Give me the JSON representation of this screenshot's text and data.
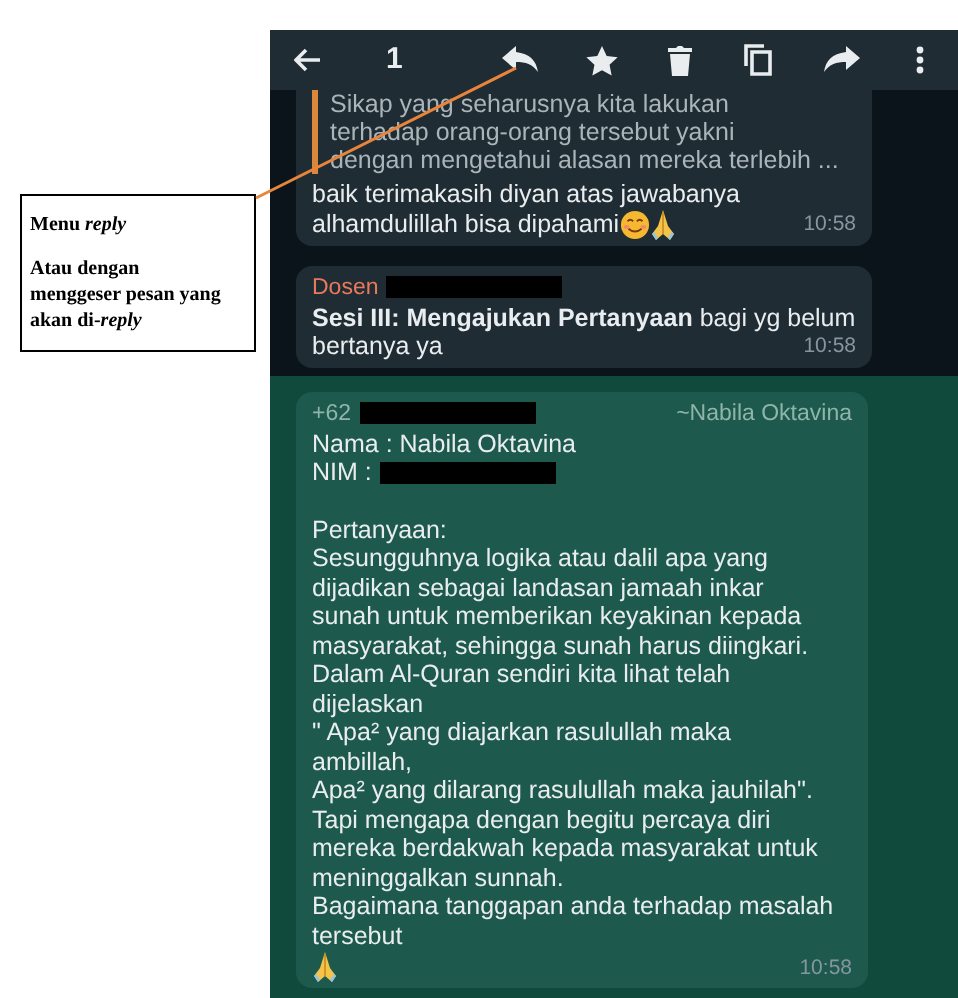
{
  "annotation": {
    "title": "Menu *reply*",
    "note": "Atau dengan menggeser pesan yang akan di-*reply*"
  },
  "toolbar": {
    "selected_count": "1"
  },
  "messages": [
    {
      "kind": "reply",
      "selected": false,
      "quote": [
        "Sikap yang seharusnya kita lakukan",
        "terhadap orang-orang tersebut yakni",
        "dengan mengetahui alasan mereka terlebih ..."
      ],
      "lines": [
        "baik terimakasih diyan atas jawabanya",
        "alhamdulillah bisa dipahami"
      ],
      "time": "10:58"
    },
    {
      "kind": "text",
      "selected": false,
      "sender": "Dosen",
      "sender_redacted": true,
      "lines": [
        "**Sesi III: Mengajukan Pertanyaan** bagi yg belum",
        "bertanya ya"
      ],
      "time": "10:58"
    },
    {
      "kind": "question",
      "selected": true,
      "sender": "+62",
      "sender_redacted": true,
      "sender_name": "~Nabila Oktavina",
      "fields": [
        {
          "text": "Nama : Nabila Oktavina",
          "redacted": false
        },
        {
          "text": "NIM :",
          "redacted": true
        }
      ],
      "lines": [
        "Pertanyaan:",
        "Sesungguhnya logika atau dalil apa yang",
        "dijadikan sebagai landasan jamaah inkar",
        "sunah untuk memberikan keyakinan kepada",
        "masyarakat, sehingga sunah harus diingkari.",
        "Dalam Al-Quran sendiri kita lihat telah",
        "dijelaskan",
        "\" Apa² yang diajarkan rasulullah maka",
        "ambillah,",
        "Apa² yang dilarang rasulullah maka jauhilah\".",
        "Tapi mengapa dengan begitu percaya diri",
        "mereka berdakwah kepada masyarakat untuk",
        "meninggalkan sunnah.",
        "Bagaimana tanggapan anda terhadap masalah",
        "tersebut"
      ],
      "time": "10:58"
    }
  ]
}
